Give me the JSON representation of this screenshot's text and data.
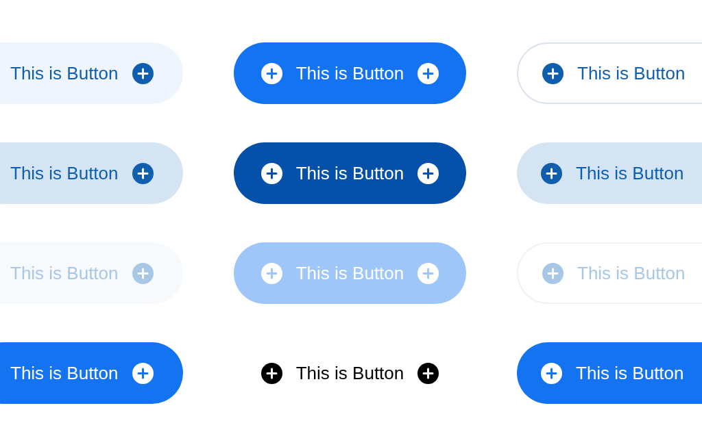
{
  "rows": [
    [
      {
        "label": "This is Button",
        "kind": "soft"
      },
      {
        "label": "This is Button",
        "kind": "solid"
      },
      {
        "label": "This is Button",
        "kind": "outline"
      }
    ],
    [
      {
        "label": "This is Button",
        "kind": "soft-hover"
      },
      {
        "label": "This is Button",
        "kind": "solid-pressed"
      },
      {
        "label": "This is Button",
        "kind": "soft-hover"
      }
    ],
    [
      {
        "label": "This is Button",
        "kind": "soft-disabled"
      },
      {
        "label": "This is Button",
        "kind": "solid-disabled"
      },
      {
        "label": "This is Button",
        "kind": "outline-disabled"
      }
    ],
    [
      {
        "label": "This is Button",
        "kind": "solid"
      },
      {
        "label": "This is Button",
        "kind": "ghost"
      },
      {
        "label": "This is Button",
        "kind": "solid"
      }
    ]
  ]
}
